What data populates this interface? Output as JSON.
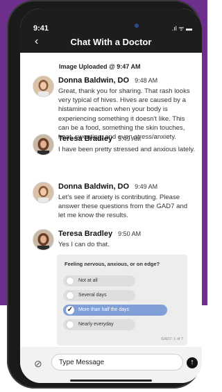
{
  "status": {
    "time": "9:41",
    "icons": ".ıl ᯤ ▬"
  },
  "header": {
    "title": "Chat With a Doctor",
    "back_icon": "chevron-left-icon"
  },
  "chat": {
    "uploaded_note": "Image Uploaded @ 9:47 AM",
    "messages": [
      {
        "name": "Donna Baldwin, DO",
        "time": "9:48 AM",
        "text": "Great, thank you for sharing. That rash looks very typical of hives. Hives are caused by a histamine reaction when your body is experiencing something it doesn't like. This can be a food, something the skin touches, heat, sweating, and even stress/anxiety."
      },
      {
        "name": "Teresa Bradley",
        "time": "9:49 AM",
        "text": "I have been pretty stressed and anxious lately."
      },
      {
        "name": "Donna Baldwin, DO",
        "time": "9:49 AM",
        "text": "Let's see if anxiety is contributing. Please answer these questions from the GAD7 and let me know the results."
      },
      {
        "name": "Teresa Bradley",
        "time": "9:50 AM",
        "text": "Yes I can do that."
      }
    ]
  },
  "survey": {
    "question": "Feeling nervous, anxious, or on edge?",
    "options": [
      "Not at all",
      "Several days",
      "More than half the days",
      "Nearly everyday"
    ],
    "selected_index": 2,
    "footer": "GAD7: 1 of 7"
  },
  "input": {
    "placeholder": "Type Message",
    "attach_icon": "paperclip-icon",
    "send_icon": "arrow-up-icon"
  },
  "colors": {
    "background": "#6e2e8b",
    "header": "#1d1d1d",
    "selected_option": "#7f9fd6"
  }
}
